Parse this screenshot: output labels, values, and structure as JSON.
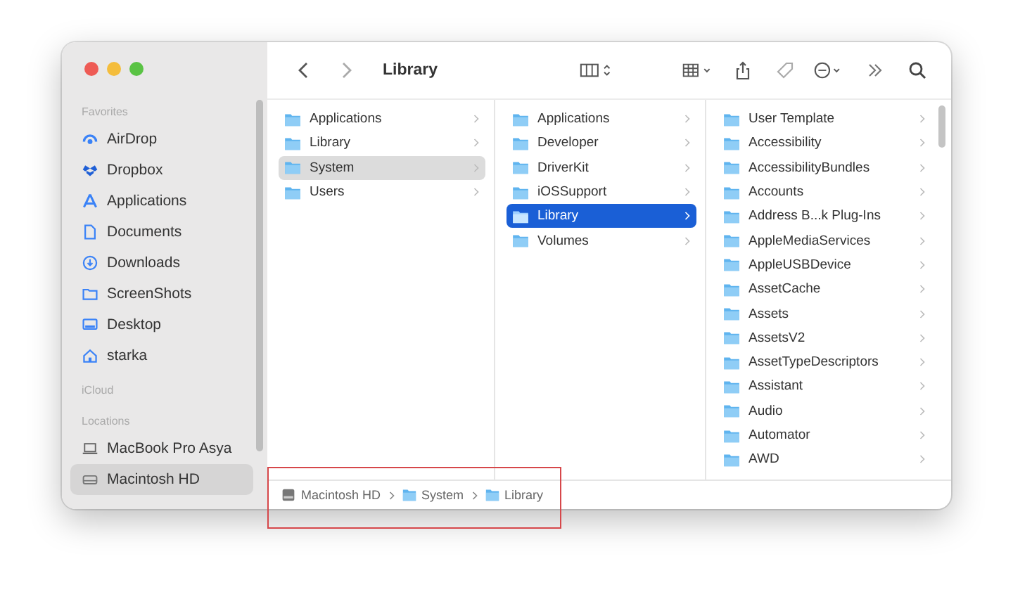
{
  "window": {
    "title": "Library"
  },
  "sidebar": {
    "sections": [
      {
        "heading": "Favorites",
        "items": [
          {
            "label": "AirDrop",
            "kind": "airdrop",
            "selected": false
          },
          {
            "label": "Dropbox",
            "kind": "dropbox",
            "selected": false
          },
          {
            "label": "Applications",
            "kind": "apps",
            "selected": false
          },
          {
            "label": "Documents",
            "kind": "document",
            "selected": false
          },
          {
            "label": "Downloads",
            "kind": "download",
            "selected": false
          },
          {
            "label": "ScreenShots",
            "kind": "folder",
            "selected": false
          },
          {
            "label": "Desktop",
            "kind": "desktop",
            "selected": false
          },
          {
            "label": "starka",
            "kind": "home",
            "selected": false
          }
        ]
      },
      {
        "heading": "iCloud"
      },
      {
        "heading": "Locations",
        "items": [
          {
            "label": "MacBook Pro Asya",
            "kind": "laptop",
            "selected": false
          },
          {
            "label": "Macintosh HD",
            "kind": "disk",
            "selected": true
          }
        ]
      }
    ]
  },
  "columns": [
    {
      "items": [
        {
          "name": "Applications",
          "selected": false
        },
        {
          "name": "Library",
          "selected": false
        },
        {
          "name": "System",
          "selected": true
        },
        {
          "name": "Users",
          "selected": false
        }
      ]
    },
    {
      "items": [
        {
          "name": "Applications",
          "selected": false
        },
        {
          "name": "Developer",
          "selected": false
        },
        {
          "name": "DriverKit",
          "selected": false
        },
        {
          "name": "iOSSupport",
          "selected": false
        },
        {
          "name": "Library",
          "selected": true
        },
        {
          "name": "Volumes",
          "selected": false
        }
      ]
    },
    {
      "items": [
        {
          "name": "User Template",
          "selected": false
        },
        {
          "name": "Accessibility",
          "selected": false
        },
        {
          "name": "AccessibilityBundles",
          "selected": false
        },
        {
          "name": "Accounts",
          "selected": false
        },
        {
          "name": "Address B...k Plug-Ins",
          "selected": false
        },
        {
          "name": "AppleMediaServices",
          "selected": false
        },
        {
          "name": "AppleUSBDevice",
          "selected": false
        },
        {
          "name": "AssetCache",
          "selected": false
        },
        {
          "name": "Assets",
          "selected": false
        },
        {
          "name": "AssetsV2",
          "selected": false
        },
        {
          "name": "AssetTypeDescriptors",
          "selected": false
        },
        {
          "name": "Assistant",
          "selected": false
        },
        {
          "name": "Audio",
          "selected": false
        },
        {
          "name": "Automator",
          "selected": false
        },
        {
          "name": "AWD",
          "selected": false
        }
      ]
    }
  ],
  "path_bar": [
    {
      "label": "Macintosh HD",
      "kind": "disk"
    },
    {
      "label": "System",
      "kind": "folder"
    },
    {
      "label": "Library",
      "kind": "folder"
    }
  ]
}
